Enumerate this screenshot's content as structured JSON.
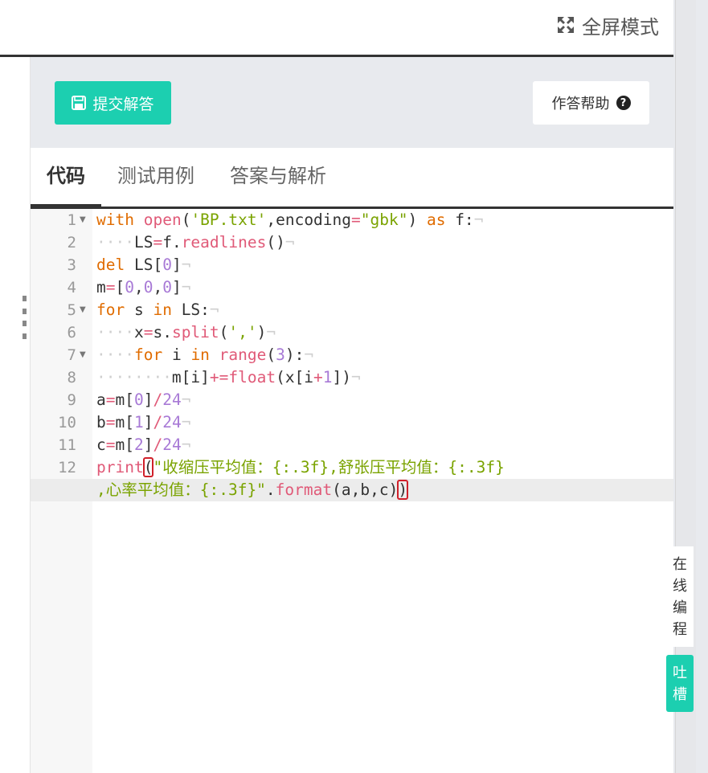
{
  "header": {
    "fullscreen_label": "全屏模式",
    "fullscreen_icon": "expand-arrows-icon"
  },
  "toolbar": {
    "submit_label": "提交解答",
    "submit_icon": "save-icon",
    "help_label": "作答帮助",
    "help_icon": "question-circle-icon"
  },
  "tabs": [
    {
      "label": "代码",
      "active": true
    },
    {
      "label": "测试用例",
      "active": false
    },
    {
      "label": "答案与解析",
      "active": false
    }
  ],
  "editor": {
    "line_numbers": [
      "1",
      "2",
      "3",
      "4",
      "5",
      "6",
      "7",
      "8",
      "9",
      "10",
      "11",
      "12"
    ],
    "lines": [
      "with open('BP.txt',encoding=\"gbk\") as f:",
      "    LS=f.readlines()",
      "del LS[0]",
      "m=[0,0,0]",
      "for s in LS:",
      "    x=s.split(',')",
      "    for i in range(3):",
      "        m[i]+=float(x[i+1])",
      "a=m[0]/24",
      "b=m[1]/24",
      "c=m[2]/24",
      "print(\"收缩压平均值：{:.3f},舒张压平均值：{:.3f},心率平均值：{:.3f}\".format(a,b,c))"
    ],
    "colors": {
      "keyword": "#e06c00",
      "function": "#e05a78",
      "string": "#7aa300",
      "number": "#a87ad6",
      "bracket_match": "#d0202a"
    }
  },
  "side": {
    "online_coding_label": [
      "在",
      "线",
      "编",
      "程"
    ],
    "feedback_label": [
      "吐",
      "槽"
    ]
  },
  "colors": {
    "accent": "#1ccfb0",
    "panel_bg": "#e8eaee"
  }
}
